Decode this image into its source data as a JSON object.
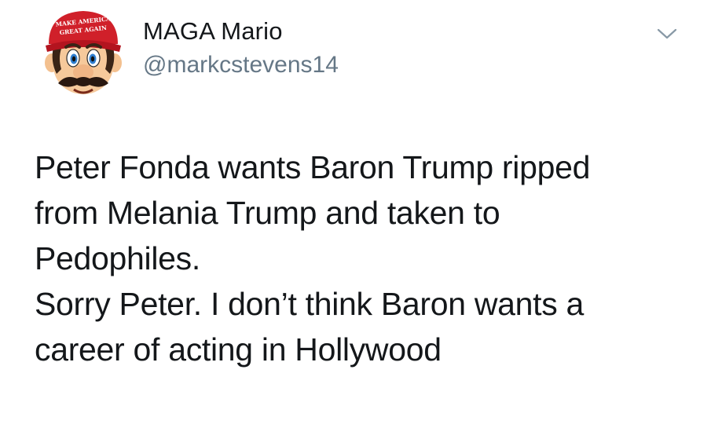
{
  "author": {
    "display_name": "MAGA Mario",
    "handle": "@markcstevens14",
    "avatar": {
      "icon": "mario-avatar-icon",
      "hat_text_line1": "MAKE AMERICA",
      "hat_text_line2": "GREAT AGAIN",
      "hat_color": "#d0202a"
    }
  },
  "menu": {
    "icon": "chevron-down-icon"
  },
  "tweet": {
    "lines": [
      "Peter Fonda wants Baron Trump ripped",
      "from Melania Trump and taken to",
      "Pedophiles.",
      "Sorry Peter.  I don’t think Baron wants a",
      "career of acting in Hollywood"
    ]
  },
  "colors": {
    "text": "#14171a",
    "secondary_text": "#657786",
    "background": "#ffffff"
  }
}
